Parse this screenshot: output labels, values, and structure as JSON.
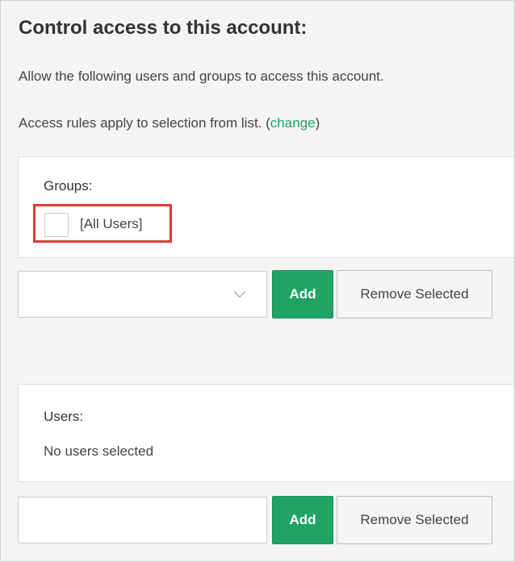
{
  "title": "Control access to this account:",
  "description": "Allow the following users and groups to access this account.",
  "rules": {
    "prefix": "Access rules apply to selection from list. (",
    "link": "change",
    "suffix": ")"
  },
  "groups": {
    "label": "Groups:",
    "items": [
      {
        "label": "[All Users]",
        "checked": false,
        "highlighted": true
      }
    ],
    "select_value": "",
    "add_label": "Add",
    "remove_label": "Remove Selected"
  },
  "users": {
    "label": "Users:",
    "empty_text": "No users selected",
    "input_value": "",
    "add_label": "Add",
    "remove_label": "Remove Selected"
  },
  "colors": {
    "accent": "#1fa463",
    "highlight": "#e23a3a",
    "background": "#f4f4f4"
  }
}
